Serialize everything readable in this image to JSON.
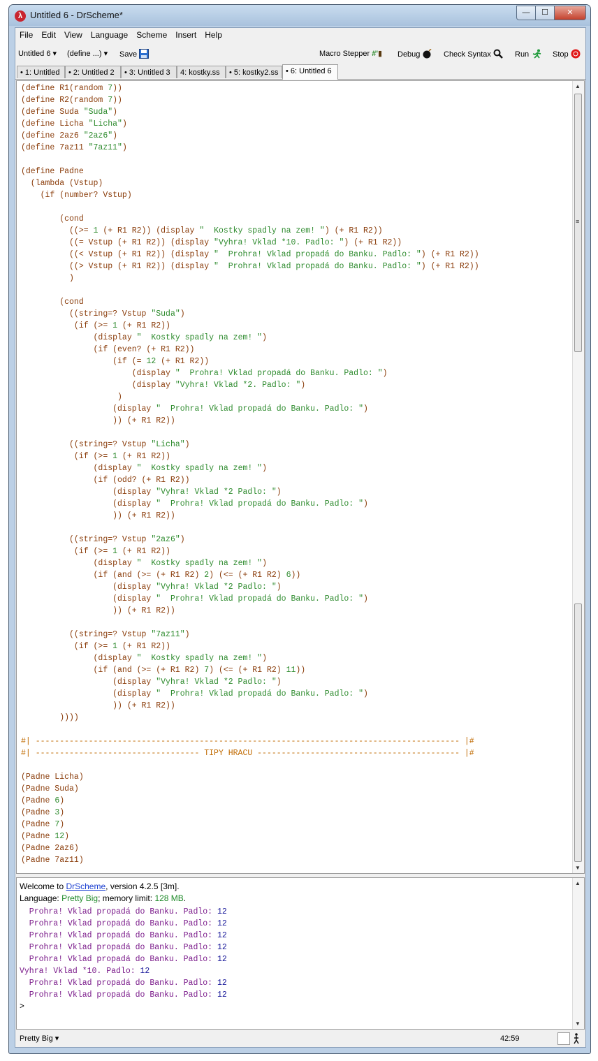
{
  "window": {
    "title": "Untitled 6 - DrScheme*"
  },
  "menubar": [
    "File",
    "Edit",
    "View",
    "Language",
    "Scheme",
    "Insert",
    "Help"
  ],
  "toolbar": {
    "file_label": "Untitled 6",
    "define_label": "(define ...)",
    "save_label": "Save",
    "macro_stepper_label": "Macro Stepper",
    "debug_label": "Debug",
    "check_syntax_label": "Check Syntax",
    "run_label": "Run",
    "stop_label": "Stop"
  },
  "tabs": [
    "• 1: Untitled",
    "• 2: Untitled 2",
    "• 3: Untitled 3",
    "4: kostky.ss",
    "• 5: kostky2.ss",
    "• 6: Untitled 6"
  ],
  "editor_lines": [
    "(define R1(random 7))",
    "(define R2(random 7))",
    "(define Suda \"Suda\")",
    "(define Licha \"Licha\")",
    "(define 2az6 \"2az6\")",
    "(define 7az11 \"7az11\")",
    "",
    "(define Padne",
    "  (lambda (Vstup)",
    "    (if (number? Vstup)",
    "",
    "        (cond",
    "          ((>= 1 (+ R1 R2)) (display \"  Kostky spadly na zem! \") (+ R1 R2))",
    "          ((= Vstup (+ R1 R2)) (display \"Vyhra! Vklad *10. Padlo: \") (+ R1 R2))",
    "          ((< Vstup (+ R1 R2)) (display \"  Prohra! Vklad propadá do Banku. Padlo: \") (+ R1 R2))",
    "          ((> Vstup (+ R1 R2)) (display \"  Prohra! Vklad propadá do Banku. Padlo: \") (+ R1 R2))",
    "          )",
    "",
    "        (cond",
    "          ((string=? Vstup \"Suda\")",
    "           (if (>= 1 (+ R1 R2))",
    "               (display \"  Kostky spadly na zem! \")",
    "               (if (even? (+ R1 R2))",
    "                   (if (= 12 (+ R1 R2))",
    "                       (display \"  Prohra! Vklad propadá do Banku. Padlo: \")",
    "                       (display \"Vyhra! Vklad *2. Padlo: \")",
    "                    )",
    "                   (display \"  Prohra! Vklad propadá do Banku. Padlo: \")",
    "                   )) (+ R1 R2))",
    "",
    "          ((string=? Vstup \"Licha\")",
    "           (if (>= 1 (+ R1 R2))",
    "               (display \"  Kostky spadly na zem! \")",
    "               (if (odd? (+ R1 R2))",
    "                   (display \"Vyhra! Vklad *2 Padlo: \")",
    "                   (display \"  Prohra! Vklad propadá do Banku. Padlo: \")",
    "                   )) (+ R1 R2))",
    "",
    "          ((string=? Vstup \"2az6\")",
    "           (if (>= 1 (+ R1 R2))",
    "               (display \"  Kostky spadly na zem! \")",
    "               (if (and (>= (+ R1 R2) 2) (<= (+ R1 R2) 6))",
    "                   (display \"Vyhra! Vklad *2 Padlo: \")",
    "                   (display \"  Prohra! Vklad propadá do Banku. Padlo: \")",
    "                   )) (+ R1 R2))",
    "",
    "          ((string=? Vstup \"7az11\")",
    "           (if (>= 1 (+ R1 R2))",
    "               (display \"  Kostky spadly na zem! \")",
    "               (if (and (>= (+ R1 R2) 7) (<= (+ R1 R2) 11))",
    "                   (display \"Vyhra! Vklad *2 Padlo: \")",
    "                   (display \"  Prohra! Vklad propadá do Banku. Padlo: \")",
    "                   )) (+ R1 R2))",
    "        ))))",
    "",
    "#| ---------------------------------------------------------------------------------------- |#",
    "#| ---------------------------------- TIPY HRACU ------------------------------------------ |#",
    "",
    "(Padne Licha)",
    "(Padne Suda)",
    "(Padne 6)",
    "(Padne 3)",
    "(Padne 7)",
    "(Padne 12)",
    "(Padne 2az6)",
    "(Padne 7az11)"
  ],
  "repl": {
    "welcome_prefix": "Welcome to ",
    "welcome_link": "DrScheme",
    "welcome_suffix": ", version 4.2.5 [3m].",
    "lang_prefix": "Language: ",
    "lang_name": "Pretty Big",
    "lang_mid": "; memory limit: ",
    "lang_mem": "128 MB",
    "lang_end": ".",
    "output": [
      {
        "text": "  Prohra! Vklad propadá do Banku. Padlo: ",
        "num": "12"
      },
      {
        "text": "  Prohra! Vklad propadá do Banku. Padlo: ",
        "num": "12"
      },
      {
        "text": "  Prohra! Vklad propadá do Banku. Padlo: ",
        "num": "12"
      },
      {
        "text": "  Prohra! Vklad propadá do Banku. Padlo: ",
        "num": "12"
      },
      {
        "text": "  Prohra! Vklad propadá do Banku. Padlo: ",
        "num": "12"
      },
      {
        "text": "Vyhra! Vklad *10. Padlo: ",
        "num": "12"
      },
      {
        "text": "  Prohra! Vklad propadá do Banku. Padlo: ",
        "num": "12"
      },
      {
        "text": "  Prohra! Vklad propadá do Banku. Padlo: ",
        "num": "12"
      }
    ],
    "prompt": ">"
  },
  "status": {
    "language": "Pretty Big",
    "position": "42:59"
  },
  "colors": {
    "paren": "#8a3c0a",
    "string": "#2e8b2e",
    "comment": "#c06a00",
    "output": "#7a1a8a",
    "value": "#1a1a9a"
  }
}
